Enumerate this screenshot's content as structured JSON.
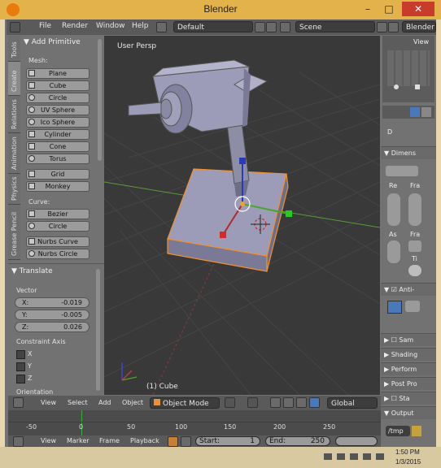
{
  "window": {
    "title": "Blender",
    "minimize": "–",
    "maximize": "□",
    "close": "✕"
  },
  "info_header": {
    "menus": [
      "File",
      "Render",
      "Window",
      "Help"
    ],
    "layout": "Default",
    "scene": "Scene",
    "engine": "Blender R"
  },
  "tool_tabs": [
    "Tools",
    "Create",
    "Relations",
    "Animation",
    "Physics",
    "Grease Pencil"
  ],
  "toolshelf": {
    "panel_title": "Add Primitive",
    "mesh_label": "Mesh:",
    "mesh_items": [
      "Plane",
      "Cube",
      "Circle",
      "UV Sphere",
      "Ico Sphere",
      "Cylinder",
      "Cone",
      "Torus"
    ],
    "other_items": [
      "Grid",
      "Monkey"
    ],
    "curve_label": "Curve:",
    "curve_items": [
      "Bezier",
      "Circle"
    ],
    "nurbs_items": [
      "Nurbs Curve",
      "Nurbs Circle"
    ]
  },
  "operator": {
    "title": "Translate",
    "vector_label": "Vector",
    "x": {
      "label": "X:",
      "value": "-0.019"
    },
    "y": {
      "label": "Y:",
      "value": "-0.005"
    },
    "z": {
      "label": "Z:",
      "value": "0.026"
    },
    "constraint_label": "Constraint Axis",
    "axes": [
      "X",
      "Y",
      "Z"
    ],
    "orientation_label": "Orientation"
  },
  "viewport": {
    "view_name": "User Persp",
    "object_label": "(1) Cube"
  },
  "right_panel": {
    "view_label": "View",
    "dimensions": "Dimens",
    "re": "Re",
    "fra": "Fra",
    "as": "As",
    "fra2": "Fra",
    "ti": "Ti",
    "anti": "Anti-",
    "sections": [
      "Sam",
      "Shading",
      "Perform",
      "Post Pro",
      "Sta",
      "Output"
    ],
    "output_path": "/tmp"
  },
  "view3d_header": {
    "menus": [
      "View",
      "Select",
      "Add",
      "Object"
    ],
    "mode": "Object Mode",
    "orientation": "Global"
  },
  "timeline": {
    "ticks": [
      "-50",
      "0",
      "50",
      "100",
      "150",
      "200",
      "250"
    ],
    "menus": [
      "View",
      "Marker",
      "Frame",
      "Playback"
    ],
    "start_label": "Start:",
    "start_value": "1",
    "end_label": "End:",
    "end_value": "250"
  },
  "taskbar": {
    "time": "1:50 PM",
    "date": "1/3/2015"
  },
  "colors": {
    "accent": "#e3b24a",
    "viewport_bg": "#393939",
    "panel": "#727272",
    "selection": "#f0a030"
  }
}
